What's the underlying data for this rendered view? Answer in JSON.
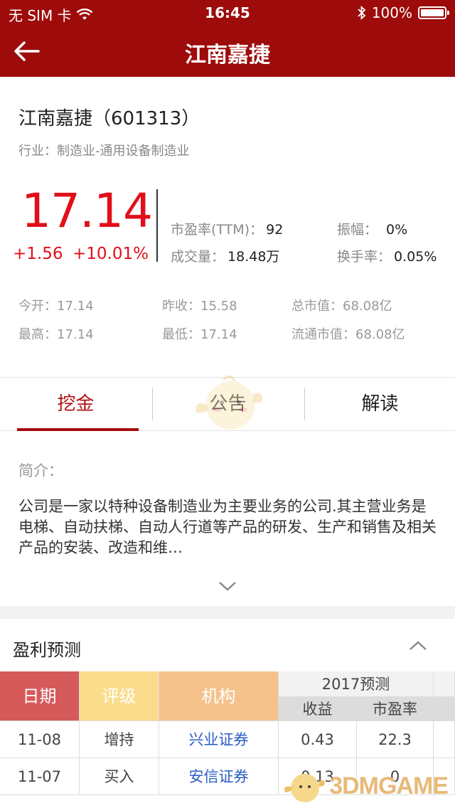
{
  "status": {
    "carrier": "无 SIM 卡",
    "time": "16:45",
    "battery": "100%"
  },
  "nav": {
    "title": "江南嘉捷"
  },
  "stock": {
    "name_code": "江南嘉捷（601313）",
    "industry": "行业：制造业-通用设备制造业",
    "price": "17.14",
    "change": "+1.56",
    "change_pct": "+10.01%",
    "pe_label": "市盈率(TTM)：",
    "pe": "92",
    "amp_label": "振幅：",
    "amp": "0%",
    "vol_label": "成交量：",
    "vol": "18.48万",
    "turn_label": "换手率：",
    "turn": "0.05%",
    "open": "今开：17.14",
    "prev_close": "昨收：15.58",
    "mktcap": "总市值：68.08亿",
    "high": "最高：17.14",
    "low": "最低：17.14",
    "float_cap": "流通市值：68.08亿"
  },
  "tabs": [
    {
      "label": "挖金"
    },
    {
      "label": "公告"
    },
    {
      "label": "解读"
    }
  ],
  "intro": {
    "label": "简介：",
    "text": "公司是一家以特种设备制造业为主要业务的公司.其主营业务是电梯、自动扶梯、自动人行道等产品的研发、生产和销售及相关产品的安装、改造和维…"
  },
  "forecast": {
    "title": "盈利预测",
    "headers": {
      "date": "日期",
      "rating": "评级",
      "org": "机构",
      "year": "2017预测",
      "eps": "收益",
      "pe": "市盈率"
    },
    "rows": [
      {
        "date": "11-08",
        "rating": "增持",
        "org": "兴业证券",
        "eps": "0.43",
        "pe": "22.3"
      },
      {
        "date": "11-07",
        "rating": "买入",
        "org": "安信证券",
        "eps": "0.13",
        "pe": "0"
      }
    ]
  },
  "watermark": {
    "text": "3DMGAME"
  },
  "colors": {
    "brand": "#9e0b0b",
    "up": "#e0101a",
    "link": "#2a5cc6"
  },
  "icons": {
    "back": "arrow-left-icon",
    "expand": "chevron-down-icon",
    "collapse": "chevron-up-icon",
    "wifi": "wifi-icon",
    "bluetooth": "bluetooth-icon"
  }
}
